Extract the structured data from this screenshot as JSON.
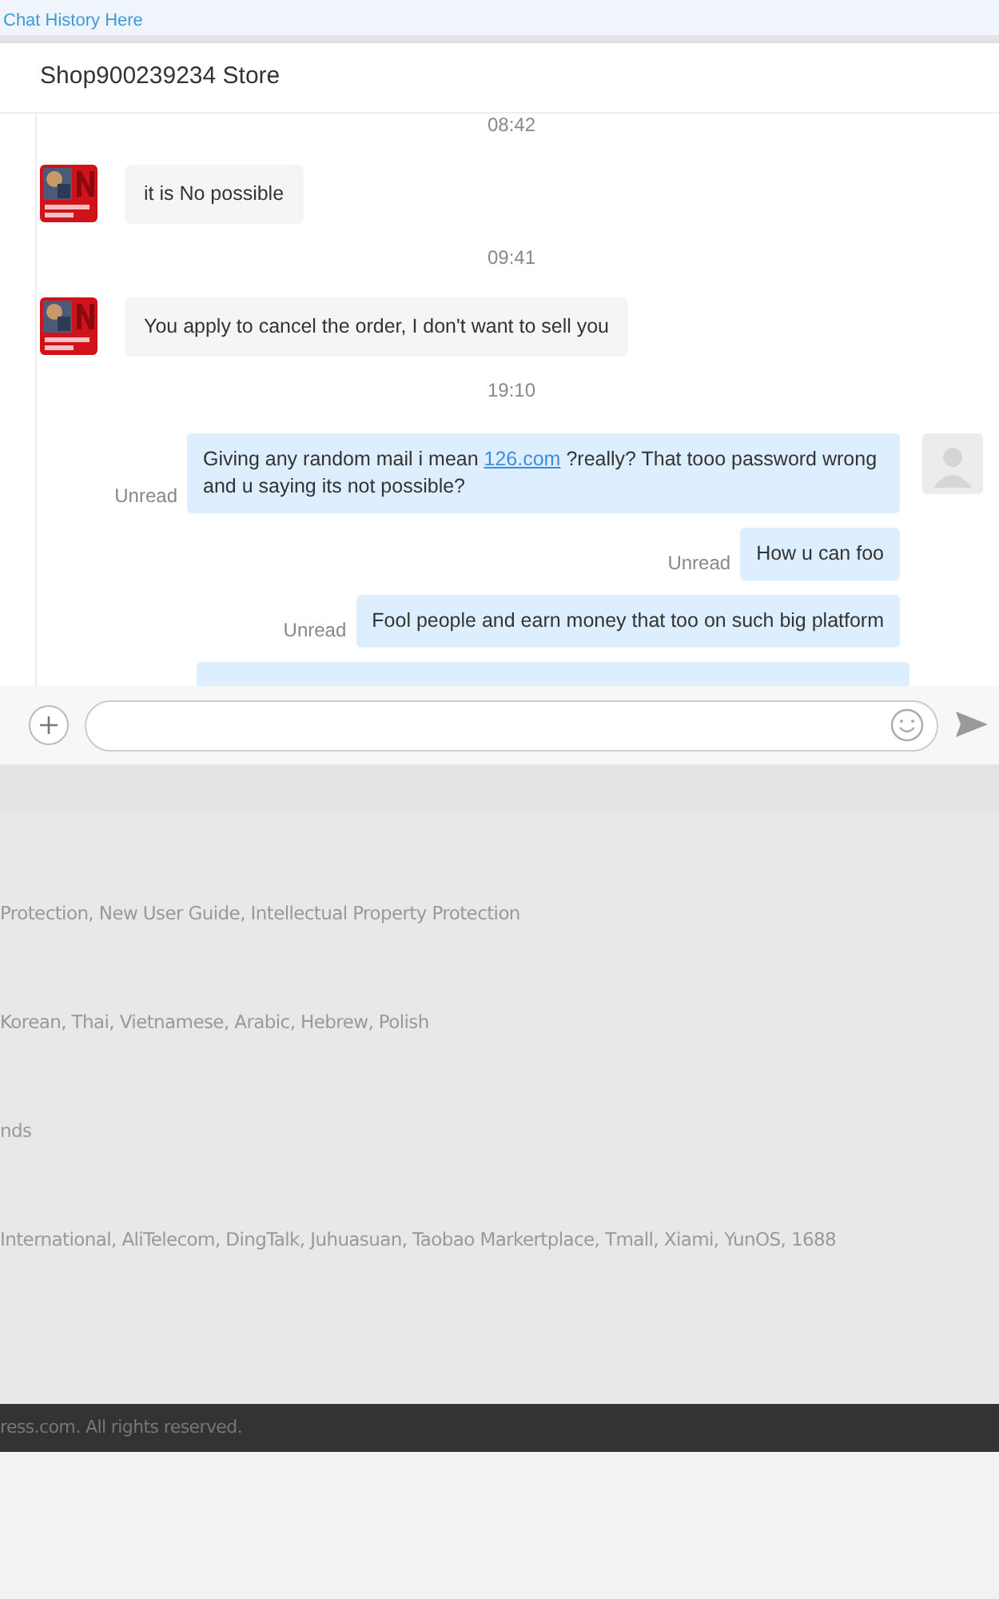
{
  "top_link": "Chat History Here",
  "chat": {
    "title": "Shop900239234 Store",
    "messages": [
      {
        "kind": "time",
        "text": "08:42"
      },
      {
        "kind": "received",
        "text": "it is No possible"
      },
      {
        "kind": "time",
        "text": "09:41"
      },
      {
        "kind": "received",
        "text": "You apply to cancel the order, I don't want to sell you"
      },
      {
        "kind": "time",
        "text": "19:10"
      },
      {
        "kind": "sent",
        "status": "Unread",
        "avatar": true,
        "parts": [
          {
            "kind": "text",
            "text": "Giving any random mail i mean "
          },
          {
            "kind": "link",
            "text": "126.com"
          },
          {
            "kind": "text",
            "text": " ?really? That tooo password wrong and u saying its not possible?"
          }
        ]
      },
      {
        "kind": "sent",
        "status": "Unread",
        "avatar": false,
        "parts": [
          {
            "kind": "text",
            "text": "How u can foo"
          }
        ]
      },
      {
        "kind": "sent",
        "status": "Unread",
        "avatar": false,
        "parts": [
          {
            "kind": "text",
            "text": "Fool people and earn money that too on such big platform"
          }
        ]
      },
      {
        "kind": "sent-cut"
      }
    ]
  },
  "footer": {
    "lines": [
      "Protection, New User Guide, Intellectual Property Protection",
      "Korean, Thai, Vietnamese, Arabic, Hebrew, Polish",
      "nds",
      " International, AliTelecom, DingTalk, Juhuasuan, Taobao Markertplace, Tmall, Xiami, YunOS, 1688"
    ],
    "copyright": "ress.com. All rights reserved."
  }
}
